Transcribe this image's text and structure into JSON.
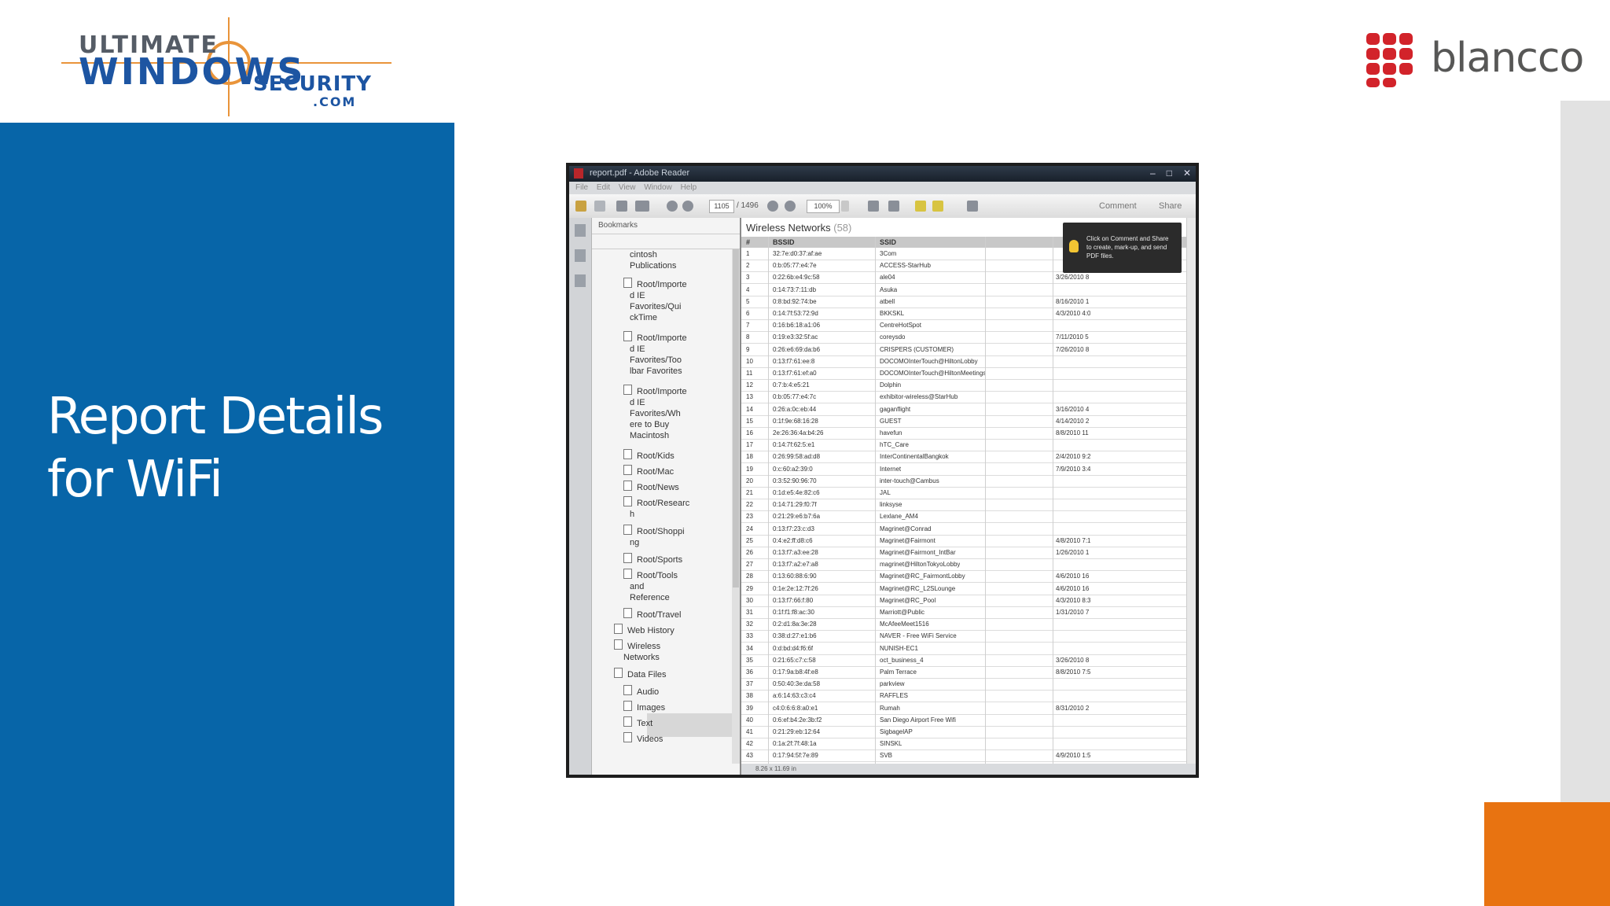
{
  "slide": {
    "title_line1": "Report Details",
    "title_line2": "for WiFi",
    "colors": {
      "panel_blue": "#0765a8",
      "accent_orange": "#e87311",
      "side_gray": "#e2e2e2",
      "blancco_red": "#d2232a"
    }
  },
  "logos": {
    "uws": {
      "line1": "ULTIMATE",
      "line2": "WINDOWS",
      "line3": "SECURITY",
      "line4": ".COM"
    },
    "blancco": {
      "name": "blancco"
    }
  },
  "reader": {
    "window_title": "report.pdf - Adobe Reader",
    "menu": [
      "File",
      "Edit",
      "View",
      "Window",
      "Help"
    ],
    "toolbar": {
      "page_current": "1105",
      "page_total": "/ 1496",
      "zoom": "100%",
      "comment": "Comment",
      "share": "Share"
    },
    "sidebar": {
      "header": "Bookmarks",
      "items": [
        "cintosh",
        "Publications",
        "Root/Importe",
        "d IE",
        "Favorites/Qui",
        "ckTime",
        "Root/Importe",
        "d IE",
        "Favorites/Too",
        "lbar Favorites",
        "Root/Importe",
        "d IE",
        "Favorites/Wh",
        "ere to Buy",
        "Macintosh",
        "Root/Kids",
        "Root/Mac",
        "Root/News",
        "Root/Researc",
        "h",
        "Root/Shoppi",
        "ng",
        "Root/Sports",
        "Root/Tools",
        "and",
        "Reference",
        "Root/Travel",
        "Web History",
        "Wireless",
        "Networks",
        "Data Files",
        "Audio",
        "Images",
        "Text",
        "Videos"
      ]
    },
    "document": {
      "title": "Wireless Networks",
      "count": "(58)",
      "columns": [
        "#",
        "BSSID",
        "SSID"
      ],
      "tooltip": "Click on Comment and Share to create, mark-up, and send PDF files.",
      "rows": [
        [
          "1",
          "32:7e:d0:37:af:ae",
          "3Com",
          ""
        ],
        [
          "2",
          "0:b:05:77:e4:7e",
          "ACCESS-StarHub",
          ""
        ],
        [
          "3",
          "0:22:6b:e4:9c:58",
          "ale04",
          "3/26/2010 8"
        ],
        [
          "4",
          "0:14:73:7:11:db",
          "Asuka",
          ""
        ],
        [
          "5",
          "0:8:bd:92:74:be",
          "atbell",
          "8/16/2010 1"
        ],
        [
          "6",
          "0:14:7f:53:72:9d",
          "BKKSKL",
          "4/3/2010 4:0"
        ],
        [
          "7",
          "0:16:b6:18:a1:06",
          "CentreHotSpot",
          ""
        ],
        [
          "8",
          "0:19:e3:32:5f:ac",
          "coreysdo",
          "7/11/2010 5"
        ],
        [
          "9",
          "0:26:e6:69:da:b6",
          "CRISPERS (CUSTOMER)",
          "7/26/2010 8"
        ],
        [
          "10",
          "0:13:f7:61:ee:8",
          "DOCOMOInterTouch@HiltonLobby",
          ""
        ],
        [
          "11",
          "0:13:f7:61:ef:a0",
          "DOCOMOInterTouch@HiltonMeetings",
          ""
        ],
        [
          "12",
          "0:7:b:4:e5:21",
          "Dolphin",
          ""
        ],
        [
          "13",
          "0:b:05:77:e4:7c",
          "exhibitor-wireless@StarHub",
          ""
        ],
        [
          "14",
          "0:26:a:0c:eb:44",
          "gaganflight",
          "3/16/2010 4"
        ],
        [
          "15",
          "0:1f:9e:68:16:28",
          "GUEST",
          "4/14/2010 2"
        ],
        [
          "16",
          "2e:26:36:4a:b4:26",
          "havefun",
          "8/8/2010 11"
        ],
        [
          "17",
          "0:14:7f:62:5:e1",
          "hTC_Care",
          ""
        ],
        [
          "18",
          "0:26:99:58:ad:d8",
          "InterContinentalBangkok",
          "2/4/2010 9:2"
        ],
        [
          "19",
          "0:c:60:a2:39:0",
          "Internet",
          "7/9/2010 3:4"
        ],
        [
          "20",
          "0:3:52:90:96:70",
          "inter-touch@Cambus",
          ""
        ],
        [
          "21",
          "0:1d:e5:4e:82:c6",
          "JAL",
          ""
        ],
        [
          "22",
          "0:14:71:29:f0:7f",
          "linksyse",
          ""
        ],
        [
          "23",
          "0:21:29:e6:b7:6a",
          "Lexlane_AM4",
          ""
        ],
        [
          "24",
          "0:13:f7:23:c:d3",
          "Magrinet@Conrad",
          ""
        ],
        [
          "25",
          "0:4:e2:ff:d8:c6",
          "Magrinet@Fairmont",
          "4/8/2010 7:1"
        ],
        [
          "26",
          "0:13:f7:a3:ee:28",
          "Magrinet@Fairmont_IntBar",
          "1/26/2010 1"
        ],
        [
          "27",
          "0:13:f7:a2:e7:a8",
          "magrinet@HiltonTokyoLobby",
          ""
        ],
        [
          "28",
          "0:13:60:88:6:90",
          "Magrinet@RC_FairmontLobby",
          "4/6/2010 16"
        ],
        [
          "29",
          "0:1e:2e:12:7f:26",
          "Magrinet@RC_L2SLounge",
          "4/6/2010 16"
        ],
        [
          "30",
          "0:13:f7:66:f:80",
          "Magrinet@RC_Pool",
          "4/3/2010 8:3"
        ],
        [
          "31",
          "0:1f:f1:f8:ac:30",
          "Marriott@Public",
          "1/31/2010 7"
        ],
        [
          "32",
          "0:2:d1:8a:3e:28",
          "McAfeeMeet1516",
          ""
        ],
        [
          "33",
          "0:38:d:27:e1:b6",
          "NAVER - Free WiFi Service",
          ""
        ],
        [
          "34",
          "0:d:bd:d4:f6:6f",
          "NUNISH-EC1",
          ""
        ],
        [
          "35",
          "0:21:65:c7:c:58",
          "oct_business_4",
          "3/26/2010 8"
        ],
        [
          "36",
          "0:17:9a:b8:4f:e8",
          "Palm Terrace",
          "8/8/2010 7:5"
        ],
        [
          "37",
          "0:50:40:3e:da:58",
          "parkview",
          ""
        ],
        [
          "38",
          "a:6:14:63:c3:c4",
          "RAFFLES",
          ""
        ],
        [
          "39",
          "c4:0:6:6:8:a0:e1",
          "Rumah",
          "8/31/2010 2"
        ],
        [
          "40",
          "0:6:ef:b4:2e:3b:f2",
          "San Diego Airport Free Wifi",
          ""
        ],
        [
          "41",
          "0:21:29:eb:12:64",
          "SigbagelAP",
          ""
        ],
        [
          "42",
          "0:1a:2f:7f:48:1a",
          "SINSKL",
          ""
        ],
        [
          "43",
          "0:17:94:5f:7e:89",
          "SVB",
          "4/9/2010 1:5"
        ]
      ]
    },
    "status": "8.26 x 11.69 in"
  }
}
